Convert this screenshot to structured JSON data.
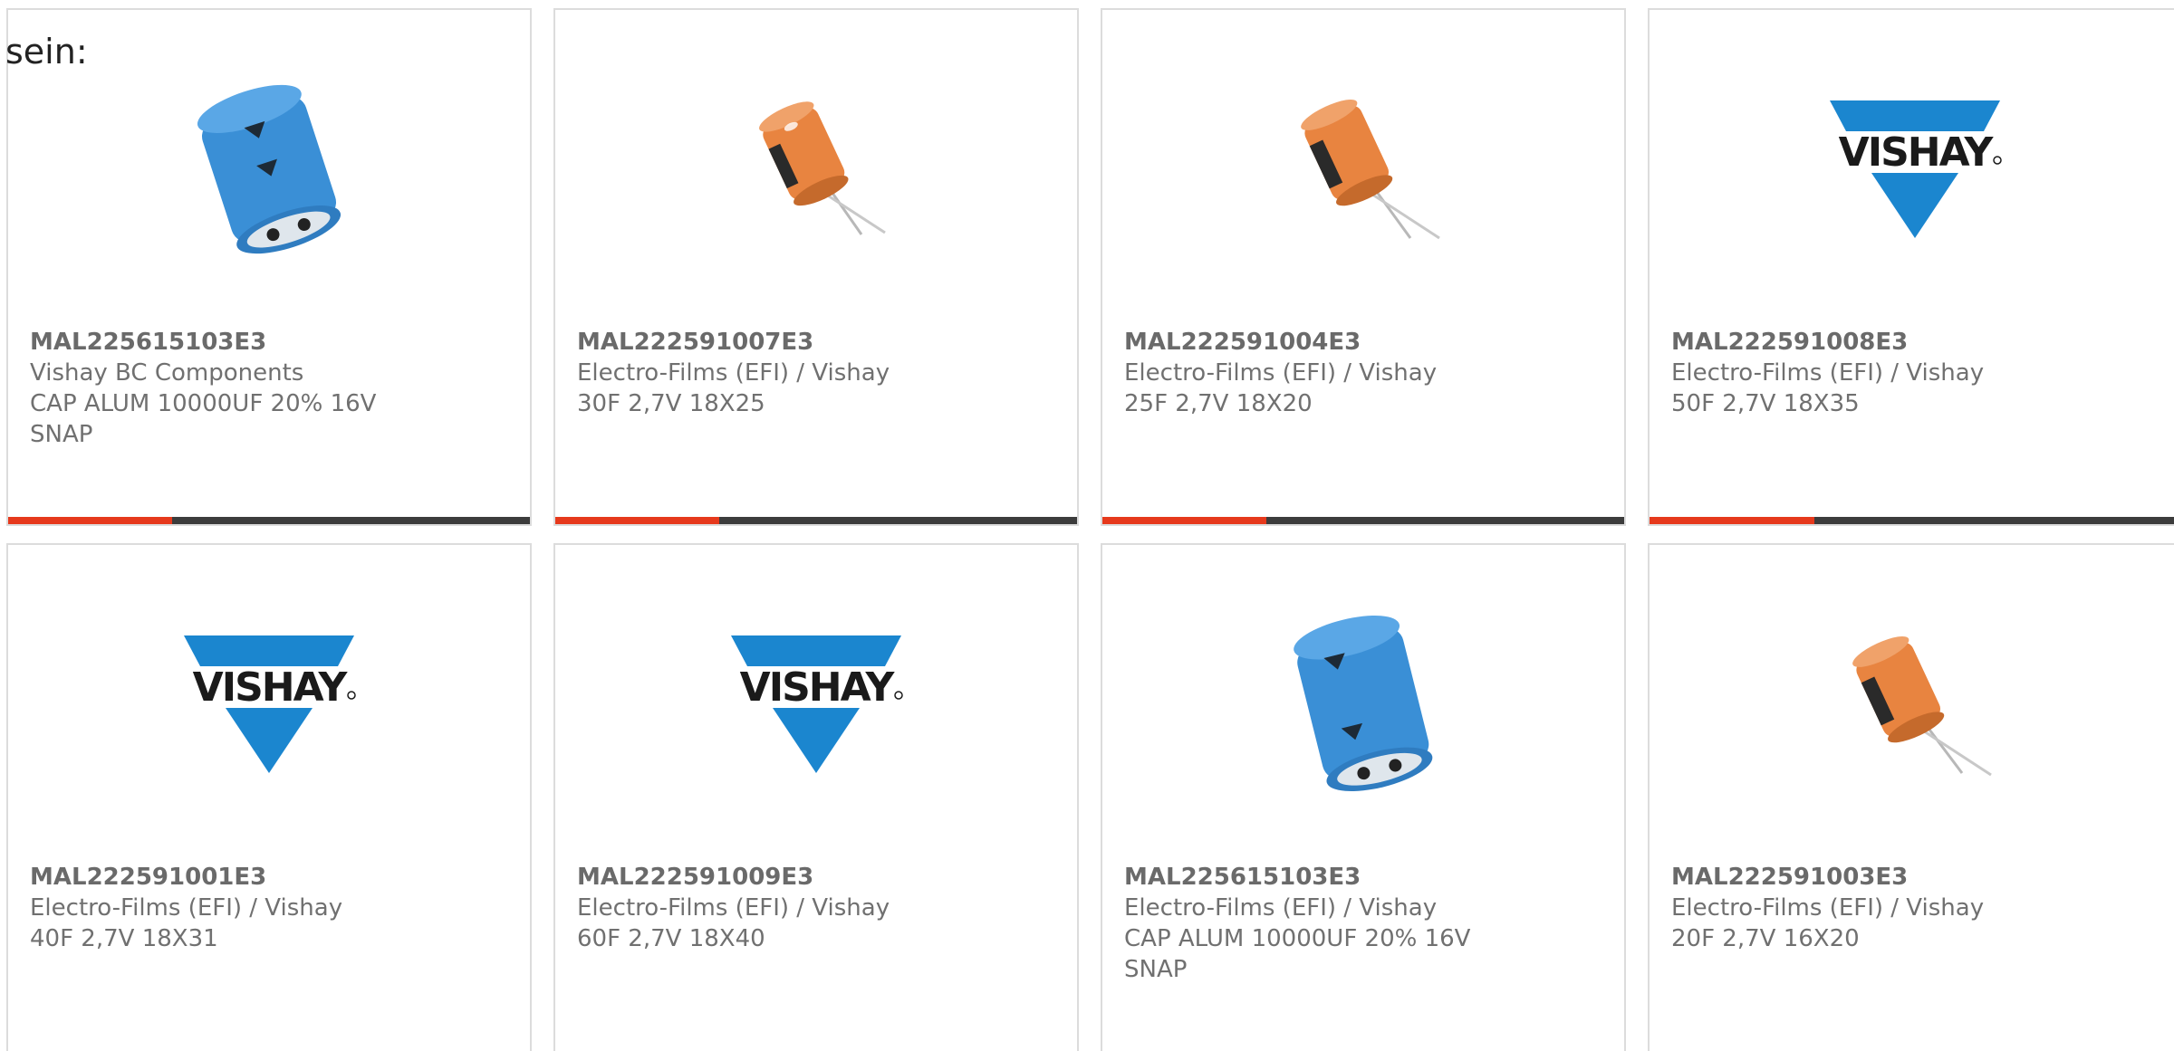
{
  "intro": "sein:",
  "colors": {
    "accent_bar": "#e6391c",
    "dark_bar": "#3c3c3c",
    "vishay_blue": "#1b86cf",
    "cap_blue": "#3a8fd6",
    "cap_orange": "#e88440"
  },
  "products": [
    {
      "part_number": "MAL225615103E3",
      "manufacturer": "Vishay BC Components",
      "description": "CAP ALUM 10000UF 20% 16V SNAP",
      "image": "blue-snap-capacitor-icon"
    },
    {
      "part_number": "MAL222591007E3",
      "manufacturer": "Electro-Films (EFI) / Vishay",
      "description": "30F 2,7V 18X25",
      "image": "orange-radial-capacitor-icon"
    },
    {
      "part_number": "MAL222591004E3",
      "manufacturer": "Electro-Films (EFI) / Vishay",
      "description": "25F 2,7V 18X20",
      "image": "orange-radial-capacitor-icon"
    },
    {
      "part_number": "MAL222591008E3",
      "manufacturer": "Electro-Films (EFI) / Vishay",
      "description": "50F 2,7V 18X35",
      "image": "vishay-logo"
    },
    {
      "part_number": "MAL222591001E3",
      "manufacturer": "Electro-Films (EFI) / Vishay",
      "description": "40F 2,7V 18X31",
      "image": "vishay-logo"
    },
    {
      "part_number": "MAL222591009E3",
      "manufacturer": "Electro-Films (EFI) / Vishay",
      "description": "60F 2,7V 18X40",
      "image": "vishay-logo"
    },
    {
      "part_number": "MAL225615103E3",
      "manufacturer": "Electro-Films (EFI) / Vishay",
      "description": "CAP ALUM 10000UF 20% 16V SNAP",
      "image": "blue-snap-capacitor-icon"
    },
    {
      "part_number": "MAL222591003E3",
      "manufacturer": "Electro-Films (EFI) / Vishay",
      "description": "20F 2,7V 16X20",
      "image": "orange-radial-capacitor-icon"
    }
  ]
}
